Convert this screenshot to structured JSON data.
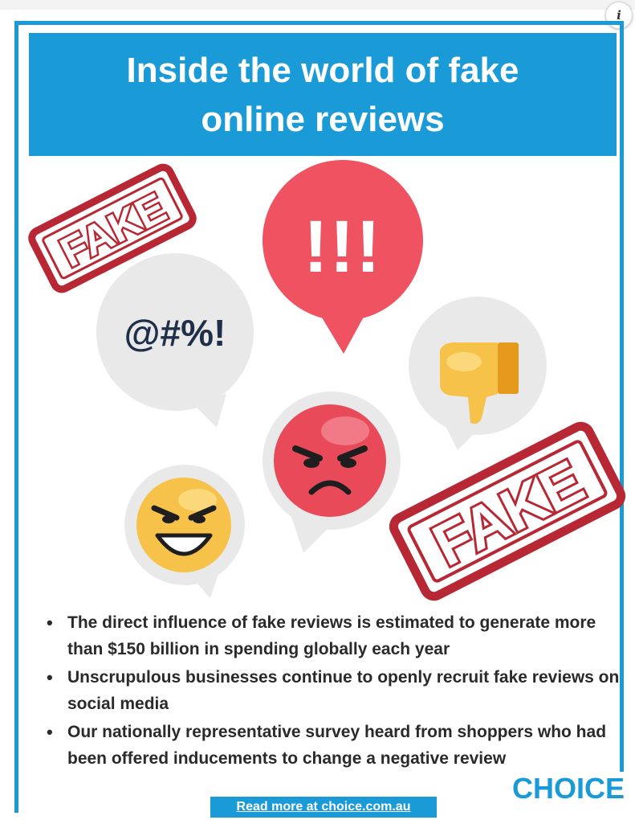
{
  "banner": {
    "title": "Inside the world of fake online reviews"
  },
  "stamps": {
    "top_left": "FAKE",
    "bottom_right": "FAKE"
  },
  "bubbles": {
    "symbols_text": "@#%!",
    "alarm_text": "!!!"
  },
  "icons": {
    "thumbs_down": "thumbs-down-icon",
    "angry_face": "angry-face-icon",
    "grin_face": "evil-grin-face-icon"
  },
  "bullets": [
    "The direct influence of fake reviews is estimated to generate more than $150 billion in spending globally each year",
    "Unscrupulous businesses continue to openly recruit fake reviews on social media",
    "Our nationally representative survey heard from shoppers who had been offered inducements to change a negative review"
  ],
  "footer": {
    "cta": "Read more at choice.com.au",
    "brand": "CHOICE"
  },
  "colors": {
    "brand_blue": "#1b9ad8",
    "stamp_red": "#b72834",
    "alarm_red": "#ef5362",
    "bubble_grey": "#e9e9e9",
    "emoji_yellow": "#f6c24a"
  }
}
